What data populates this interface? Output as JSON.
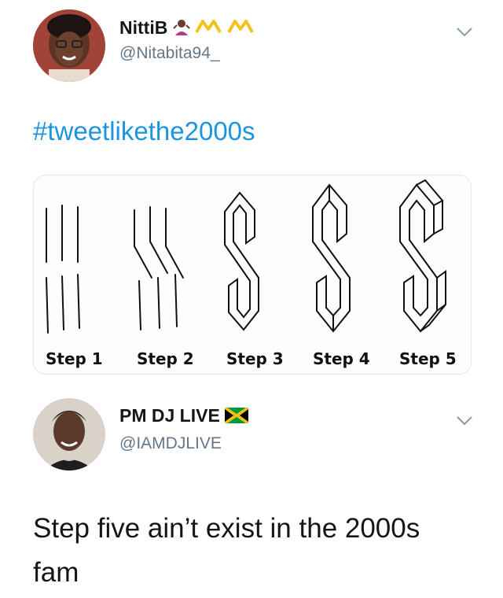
{
  "tweets": [
    {
      "name": "NittiB",
      "handle": "@Nitabita94_",
      "hashtag": "#tweetlikethe2000s",
      "emoji": [
        "person-shrugging-icon",
        "crown-icon",
        "crown-icon"
      ]
    },
    {
      "name": "PM DJ LIVE",
      "handle": "@IAMDJLIVE",
      "text": "Step five ain’t exist in the 2000s fam",
      "emoji": [
        "jamaica-flag-icon"
      ]
    }
  ],
  "media": {
    "steps": [
      "Step 1",
      "Step 2",
      "Step 3",
      "Step 4",
      "Step 5"
    ]
  },
  "colors": {
    "link": "#1b95e0",
    "secondary_text": "#657786",
    "accent_crown": "#f4c21c"
  }
}
